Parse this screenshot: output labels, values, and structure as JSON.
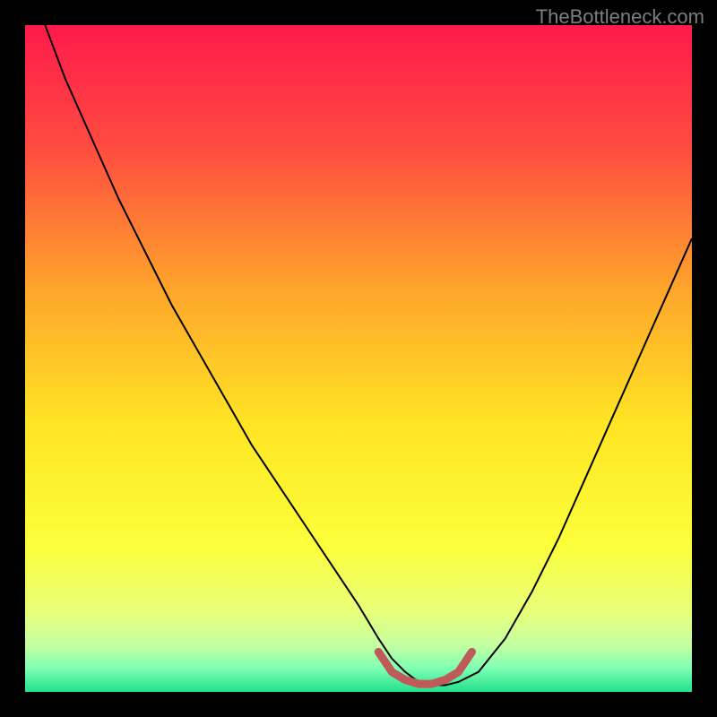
{
  "watermark": "TheBottleneck.com",
  "colors": {
    "page_bg": "#000000",
    "curve": "#000000",
    "optimal_marker": "#bf5a5a",
    "watermark": "#7e7e7e"
  },
  "chart_data": {
    "type": "line",
    "title": "",
    "xlabel": "",
    "ylabel": "",
    "xlim": [
      0,
      100
    ],
    "ylim": [
      0,
      100
    ],
    "gradient_stops": [
      {
        "offset": 0,
        "color": "#ff1a4b"
      },
      {
        "offset": 0.18,
        "color": "#ff4a40"
      },
      {
        "offset": 0.4,
        "color": "#ffa62b"
      },
      {
        "offset": 0.6,
        "color": "#ffe524"
      },
      {
        "offset": 0.78,
        "color": "#fbff3a"
      },
      {
        "offset": 0.88,
        "color": "#e8ff7a"
      },
      {
        "offset": 0.93,
        "color": "#c4ffa2"
      },
      {
        "offset": 0.965,
        "color": "#7effb3"
      },
      {
        "offset": 1.0,
        "color": "#22e08d"
      }
    ],
    "series": [
      {
        "name": "bottleneck_curve",
        "x": [
          3,
          6,
          10,
          14,
          18,
          22,
          26,
          30,
          34,
          38,
          42,
          46,
          50,
          53,
          55,
          57,
          59,
          61,
          63,
          65,
          68,
          72,
          76,
          80,
          84,
          88,
          92,
          96,
          100
        ],
        "y": [
          100,
          92,
          83,
          74,
          66,
          58,
          51,
          44,
          37,
          31,
          25,
          19,
          13,
          8,
          5,
          3,
          1.5,
          1,
          1,
          1.5,
          3,
          8,
          15,
          23,
          32,
          41,
          50,
          59,
          68
        ]
      }
    ],
    "optimal_zone": {
      "x": [
        53,
        55,
        57,
        59,
        61,
        63,
        65,
        67
      ],
      "y": [
        6,
        3,
        1.8,
        1.2,
        1.2,
        1.8,
        3,
        6
      ]
    }
  }
}
